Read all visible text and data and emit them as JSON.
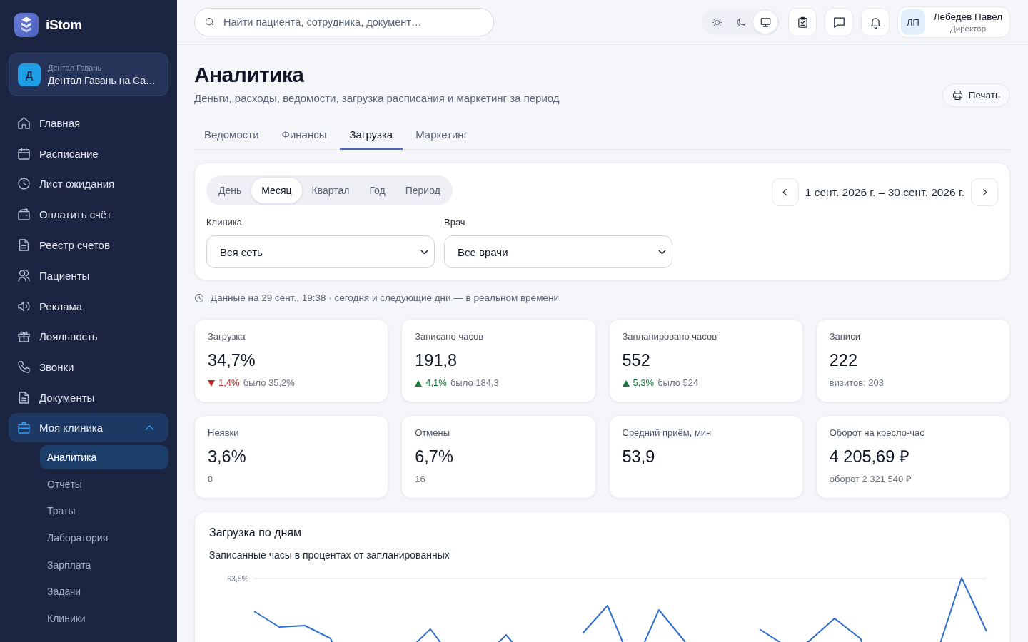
{
  "sidebar": {
    "brand": "iStom",
    "clinic": {
      "initial": "Д",
      "network": "Дентал Гавань",
      "name": "Дентал Гавань на Са…"
    },
    "nav": [
      {
        "label": "Главная",
        "selected": false
      },
      {
        "label": "Расписание",
        "selected": false
      },
      {
        "label": "Лист ожидания",
        "selected": false
      },
      {
        "label": "Оплатить счёт",
        "selected": false
      },
      {
        "label": "Реестр счетов",
        "selected": false
      },
      {
        "label": "Пациенты",
        "selected": false
      },
      {
        "label": "Реклама",
        "selected": false
      },
      {
        "label": "Лояльность",
        "selected": false
      },
      {
        "label": "Звонки",
        "selected": false
      },
      {
        "label": "Документы",
        "selected": false
      },
      {
        "label": "Моя клиника",
        "selected": true,
        "expanded": true,
        "children": [
          {
            "label": "Аналитика",
            "selected": true
          },
          {
            "label": "Отчёты",
            "selected": false
          },
          {
            "label": "Траты",
            "selected": false
          },
          {
            "label": "Лаборатория",
            "selected": false
          },
          {
            "label": "Зарплата",
            "selected": false
          },
          {
            "label": "Задачи",
            "selected": false
          },
          {
            "label": "Клиники",
            "selected": false
          }
        ]
      }
    ]
  },
  "topbar": {
    "search": {
      "placeholder": "Найти пациента, сотрудника, документ…"
    },
    "theme_modes": [
      {
        "selected": false
      },
      {
        "selected": false
      },
      {
        "selected": true
      }
    ],
    "user": {
      "initials": "ЛП",
      "name": "Лебедев Павел",
      "role": "Директор"
    }
  },
  "header": {
    "title": "Аналитика",
    "subtitle": "Деньги, расходы, ведомости, загрузка расписания и маркетинг за период",
    "print_button": "Печать"
  },
  "tabs": [
    {
      "label": "Ведомости",
      "selected": false
    },
    {
      "label": "Финансы",
      "selected": false
    },
    {
      "label": "Загрузка",
      "selected": true
    },
    {
      "label": "Маркетинг",
      "selected": false
    }
  ],
  "filters": {
    "periods": [
      {
        "label": "День",
        "selected": false
      },
      {
        "label": "Месяц",
        "selected": true
      },
      {
        "label": "Квартал",
        "selected": false
      },
      {
        "label": "Год",
        "selected": false
      },
      {
        "label": "Период",
        "selected": false
      }
    ],
    "date_range": "1 сент. 2026 г. – 30 сент. 2026 г.",
    "fields": [
      {
        "label": "Клиника",
        "value": "Вся сеть"
      },
      {
        "label": "Врач",
        "value": "Все врачи"
      }
    ]
  },
  "status_line": "Данные на 29 сент., 19:38 · сегодня и следующие дни — в реальном времени",
  "metrics": [
    {
      "label": "Загрузка",
      "value": "34,7%",
      "delta": {
        "kind": "down",
        "value": "1,4%",
        "previous": "было 35,2%"
      }
    },
    {
      "label": "Записано часов",
      "value": "191,8",
      "delta": {
        "kind": "up",
        "value": "4,1%",
        "previous": "было 184,3"
      }
    },
    {
      "label": "Запланировано часов",
      "value": "552",
      "delta": {
        "kind": "up",
        "value": "5,3%",
        "previous": "было 524"
      }
    },
    {
      "label": "Записи",
      "value": "222",
      "note": "визитов: 203"
    },
    {
      "label": "Неявки",
      "value": "3,6%",
      "note": "8"
    },
    {
      "label": "Отмены",
      "value": "6,7%",
      "note": "16"
    },
    {
      "label": "Средний приём, мин",
      "value": "53,9"
    },
    {
      "label": "Оборот на кресло-час",
      "value": "4 205,69 ₽",
      "note": "оборот 2 321 540 ₽"
    }
  ],
  "chart": {
    "title": "Загрузка по дням",
    "subtitle": "Записанные часы в процентах от запланированных",
    "tick_label": "63,5%"
  }
}
